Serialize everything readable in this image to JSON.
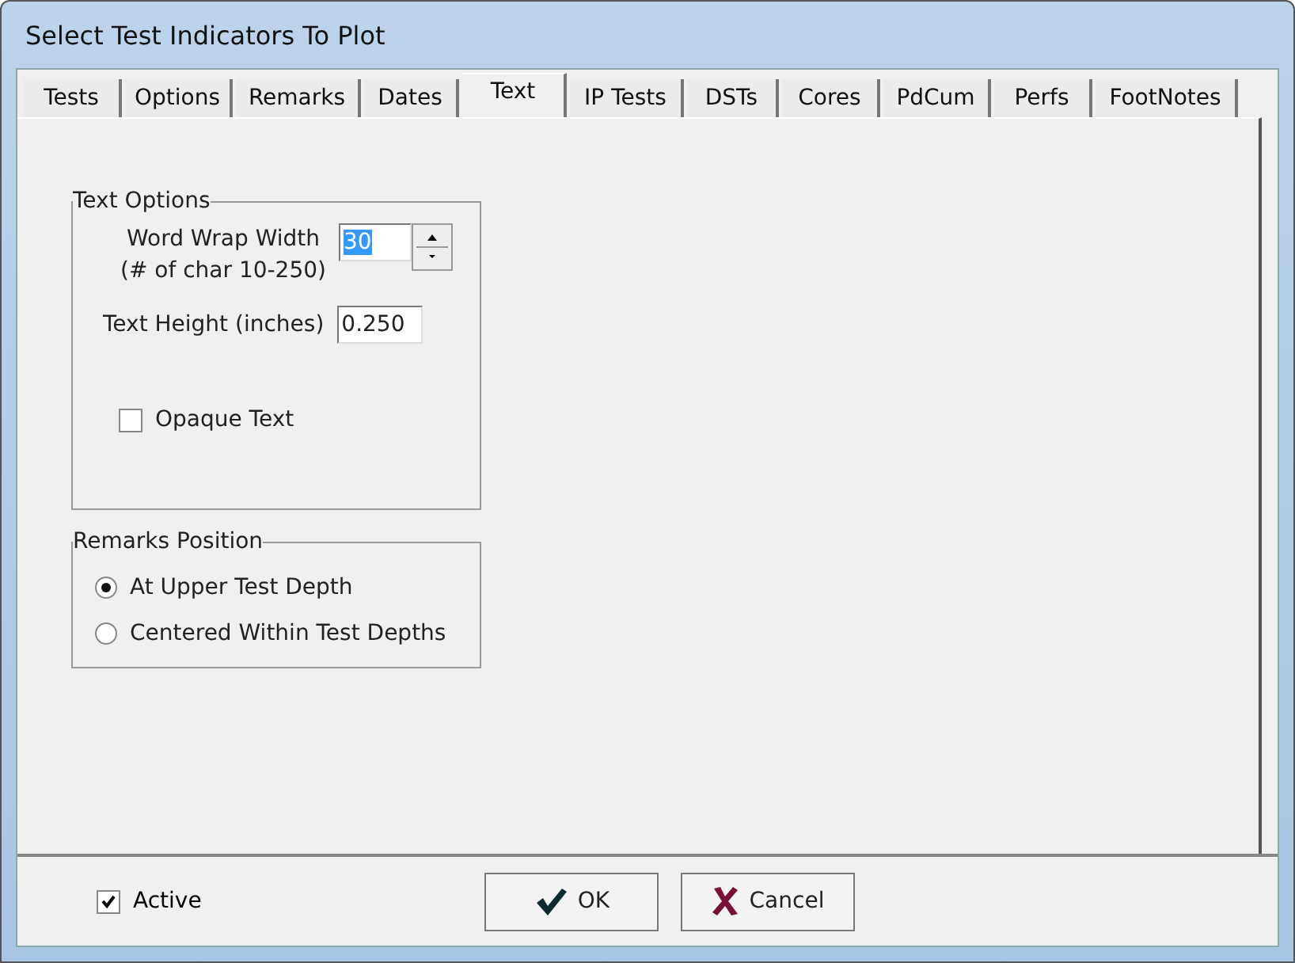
{
  "window": {
    "title": "Select Test Indicators To Plot"
  },
  "tabs": [
    {
      "label": "Tests",
      "selected": false
    },
    {
      "label": "Options",
      "selected": false
    },
    {
      "label": "Remarks",
      "selected": false
    },
    {
      "label": "Dates",
      "selected": false
    },
    {
      "label": "Text",
      "selected": true
    },
    {
      "label": "IP Tests",
      "selected": false
    },
    {
      "label": "DSTs",
      "selected": false
    },
    {
      "label": "Cores",
      "selected": false
    },
    {
      "label": "PdCum",
      "selected": false
    },
    {
      "label": "Perfs",
      "selected": false
    },
    {
      "label": "FootNotes",
      "selected": false
    }
  ],
  "text_options": {
    "title": "Text Options",
    "word_wrap_label": "Word Wrap Width",
    "word_wrap_hint": "(# of char 10-250)",
    "word_wrap_value": "30",
    "text_height_label": "Text Height (inches)",
    "text_height_value": "0.250",
    "opaque_text": {
      "label": "Opaque Text",
      "checked": false
    }
  },
  "remarks_position": {
    "title": "Remarks Position",
    "options": [
      {
        "label": "At Upper Test Depth",
        "selected": true
      },
      {
        "label": "Centered Within Test Depths",
        "selected": false
      }
    ]
  },
  "active": {
    "label": "Active",
    "checked": true
  },
  "buttons": [
    {
      "kind": "ok",
      "label": "OK"
    },
    {
      "kind": "cancel",
      "label": "Cancel"
    }
  ]
}
